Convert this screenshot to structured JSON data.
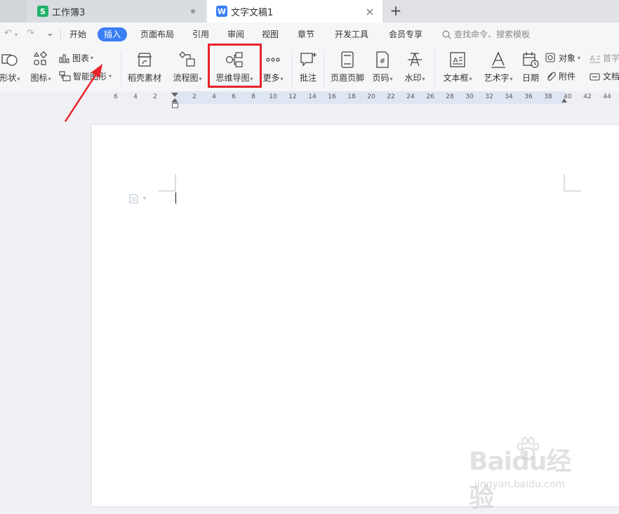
{
  "tabs": {
    "sheet": {
      "icon_glyph": "S",
      "title": "工作簿3"
    },
    "doc": {
      "icon_glyph": "W",
      "title": "文字文稿1"
    },
    "close_glyph": "×",
    "new_tab_glyph": "+"
  },
  "quick_access": {
    "undo_glyph": "↶",
    "redo_glyph": "↷",
    "customize_glyph": "⌄"
  },
  "menu": {
    "items": [
      "开始",
      "插入",
      "页面布局",
      "引用",
      "审阅",
      "视图",
      "章节",
      "开发工具",
      "会员专享"
    ],
    "active": "插入",
    "search_placeholder": "查找命令、搜索模板"
  },
  "ribbon": {
    "shape": "形状",
    "icon_lib": "图标",
    "chart": "图表",
    "smart_graphic": "智能图形",
    "material": "稻壳素材",
    "flowchart": "流程图",
    "mindmap": "思维导图",
    "more": "更多",
    "comment": "批注",
    "header_footer": "页眉页脚",
    "page_number": "页码",
    "watermark": "水印",
    "textbox": "文本框",
    "wordart": "艺术字",
    "date": "日期",
    "object": "对象",
    "attachment": "附件",
    "dropcap": "首字",
    "doc_part": "文档"
  },
  "ruler": {
    "labels": [
      "6",
      "4",
      "2",
      "2",
      "4",
      "6",
      "8",
      "10",
      "12",
      "14",
      "16",
      "18",
      "20",
      "22",
      "24",
      "26",
      "28",
      "30",
      "32",
      "34",
      "36",
      "38",
      "40",
      "42",
      "44"
    ]
  },
  "watermark_logo": {
    "brand": "Baidu经验",
    "url": "jingyan.baidu.com"
  },
  "colors": {
    "accent": "#3a7ff5",
    "highlight": "#e8232a",
    "sheet_green": "#23b26d"
  }
}
